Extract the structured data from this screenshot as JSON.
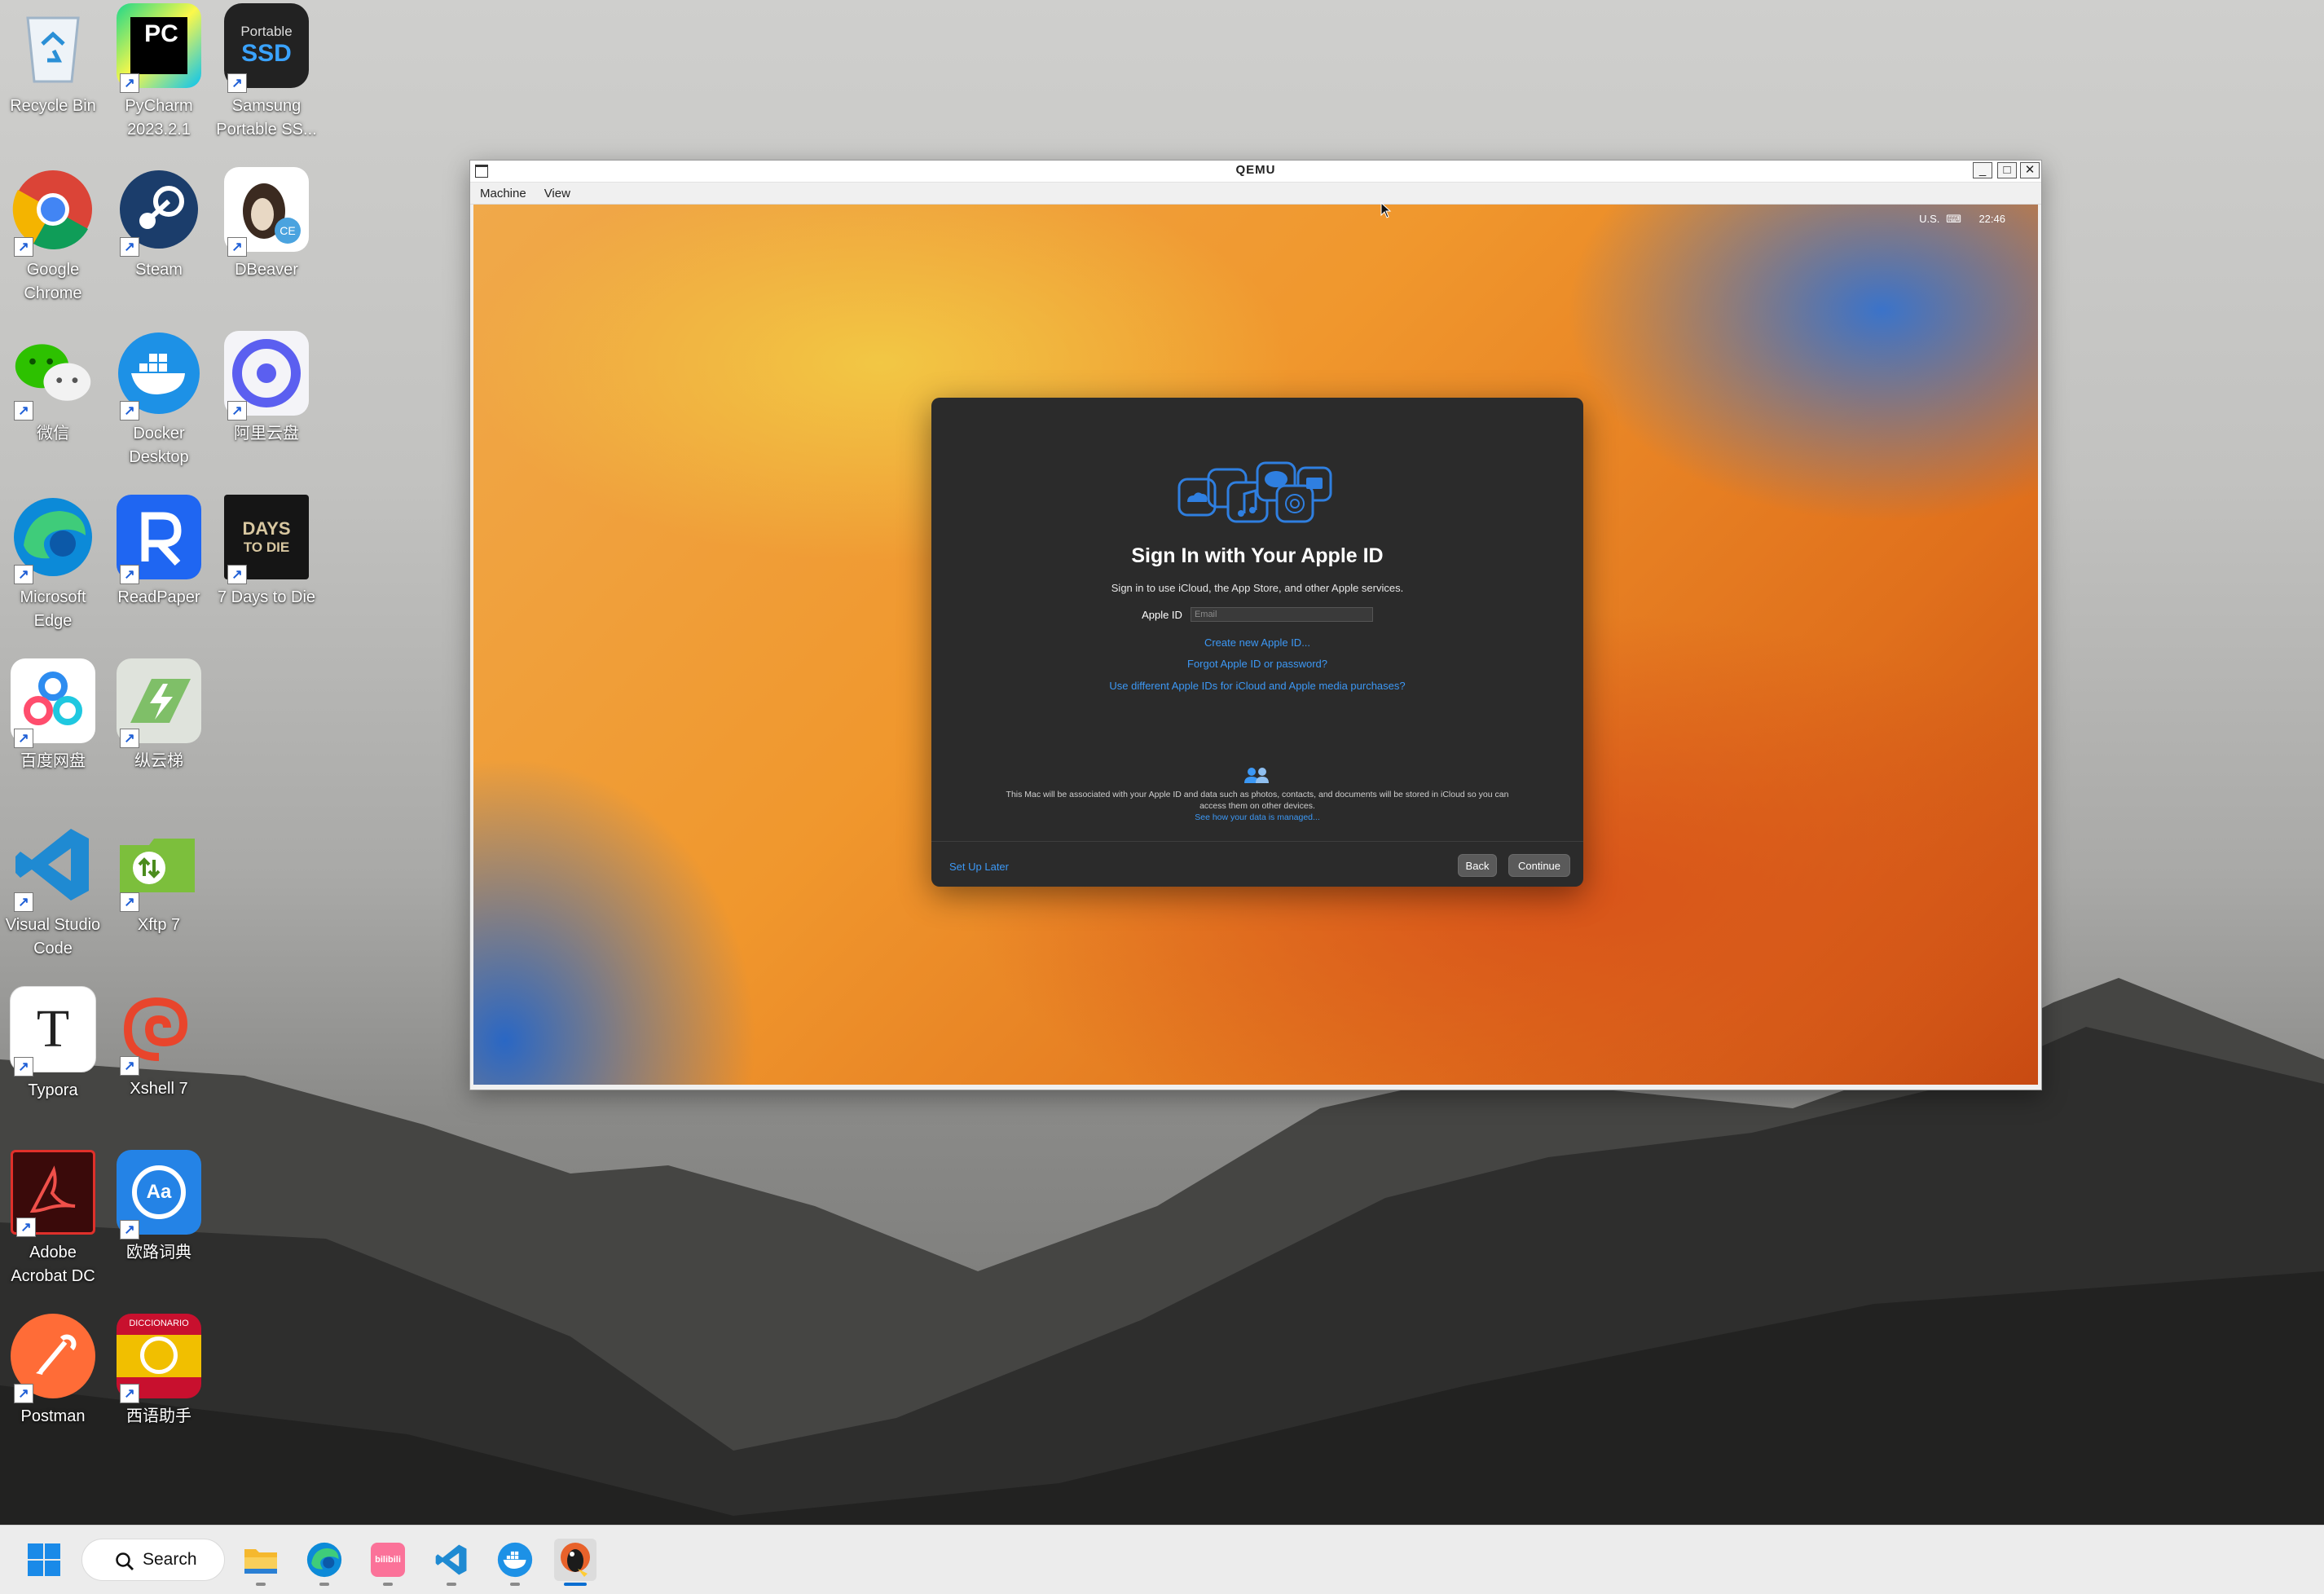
{
  "desktop": {
    "icons": [
      {
        "label": "Recycle Bin",
        "icon": "recycle-bin-icon"
      },
      {
        "label": "PyCharm\n2023.2.1",
        "icon": "pycharm-icon"
      },
      {
        "label": "Samsung\nPortable SS...",
        "icon": "samsung-portable-ssd-icon"
      },
      {
        "label": "Google\nChrome",
        "icon": "chrome-icon"
      },
      {
        "label": "Steam",
        "icon": "steam-icon"
      },
      {
        "label": "DBeaver",
        "icon": "dbeaver-icon"
      },
      {
        "label": "微信",
        "icon": "wechat-icon"
      },
      {
        "label": "Docker\nDesktop",
        "icon": "docker-icon"
      },
      {
        "label": "阿里云盘",
        "icon": "aliyun-drive-icon"
      },
      {
        "label": "Microsoft\nEdge",
        "icon": "edge-icon"
      },
      {
        "label": "ReadPaper",
        "icon": "readpaper-icon"
      },
      {
        "label": "7 Days to Die",
        "icon": "seven-days-to-die-icon"
      },
      {
        "label": "百度网盘",
        "icon": "baidu-netdisk-icon"
      },
      {
        "label": "纵云梯",
        "icon": "zongyunti-icon"
      },
      {
        "label": "Visual Studio\nCode",
        "icon": "vscode-icon"
      },
      {
        "label": "Xftp 7",
        "icon": "xftp-icon"
      },
      {
        "label": "Typora",
        "icon": "typora-icon"
      },
      {
        "label": "Xshell 7",
        "icon": "xshell-icon"
      },
      {
        "label": "Adobe\nAcrobat DC",
        "icon": "acrobat-icon"
      },
      {
        "label": "欧路词典",
        "icon": "eudic-icon"
      },
      {
        "label": "Postman",
        "icon": "postman-icon"
      },
      {
        "label": "西语助手",
        "icon": "spanish-assistant-icon"
      }
    ],
    "tile_text": {
      "pycharm": "PC",
      "samsung_top": "Portable",
      "samsung_main": "SSD",
      "dbeaver_badge": "CE",
      "seven_days_1": "DAYS",
      "seven_days_2": "TO DIE",
      "typora": "T",
      "eudic": "Aa",
      "spanish_top": "DICCIONARIO"
    }
  },
  "qemu": {
    "title": "QEMU",
    "menu": [
      "Machine",
      "View"
    ],
    "controls": {
      "minimize": "_",
      "maximize": "□",
      "close": "✕"
    },
    "guest": {
      "statusbar": {
        "keyboard": "U.S.",
        "time": "22:46"
      },
      "signin": {
        "title": "Sign In with Your Apple ID",
        "subtitle": "Sign in to use iCloud, the App Store, and other Apple services.",
        "field_label": "Apple ID",
        "field_placeholder": "Email",
        "field_value": "",
        "links": [
          "Create new Apple ID...",
          "Forgot Apple ID or password?",
          "Use different Apple IDs for iCloud and Apple media purchases?"
        ],
        "footnote": "This Mac will be associated with your Apple ID and data such as photos, contacts, and documents will be stored in iCloud so you can access them on other devices.",
        "footnote_link": "See how your data is managed...",
        "setup_later": "Set Up Later",
        "back": "Back",
        "continue": "Continue"
      }
    }
  },
  "taskbar": {
    "search_label": "Search",
    "apps": [
      "file-explorer-icon",
      "edge-icon",
      "bilibili-icon",
      "vscode-icon",
      "docker-icon",
      "qemu-icon"
    ],
    "bilibili_text": "bilibili"
  },
  "colors": {
    "accent_link": "#3c98f5",
    "panel_bg": "#2b2b2b",
    "taskbar_bg": "#ececec",
    "active_indicator": "#0a6ed1"
  }
}
